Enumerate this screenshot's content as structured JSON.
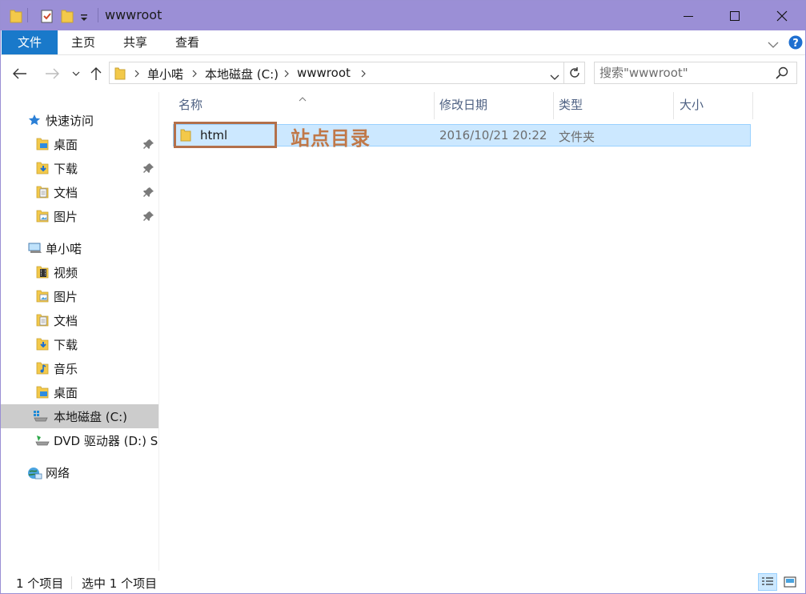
{
  "window": {
    "title": "wwwroot"
  },
  "ribbon": {
    "tabs": [
      {
        "label": "文件"
      },
      {
        "label": "主页"
      },
      {
        "label": "共享"
      },
      {
        "label": "查看"
      }
    ]
  },
  "address": {
    "crumbs": [
      "单小喏",
      "本地磁盘 (C:)",
      "wwwroot"
    ],
    "search_placeholder": "搜索\"wwwroot\""
  },
  "navpane": {
    "quick_access": {
      "label": "快速访问",
      "items": [
        {
          "label": "桌面",
          "icon": "desktop-folder-icon",
          "pinned": true
        },
        {
          "label": "下载",
          "icon": "downloads-folder-icon",
          "pinned": true
        },
        {
          "label": "文档",
          "icon": "documents-folder-icon",
          "pinned": true
        },
        {
          "label": "图片",
          "icon": "pictures-folder-icon",
          "pinned": true
        }
      ]
    },
    "this_pc": {
      "label": "单小喏",
      "items": [
        {
          "label": "视频",
          "icon": "videos-folder-icon"
        },
        {
          "label": "图片",
          "icon": "pictures-folder-icon"
        },
        {
          "label": "文档",
          "icon": "documents-folder-icon"
        },
        {
          "label": "下载",
          "icon": "downloads-folder-icon"
        },
        {
          "label": "音乐",
          "icon": "music-folder-icon"
        },
        {
          "label": "桌面",
          "icon": "desktop-folder-icon"
        },
        {
          "label": "本地磁盘 (C:)",
          "icon": "local-disk-icon",
          "selected": true
        },
        {
          "label": "DVD 驱动器 (D:) SS",
          "icon": "dvd-drive-icon"
        }
      ]
    },
    "network": {
      "label": "网络"
    }
  },
  "columns": {
    "name": "名称",
    "modified": "修改日期",
    "type": "类型",
    "size": "大小"
  },
  "files": [
    {
      "name": "html",
      "modified": "2016/10/21 20:22",
      "type": "文件夹",
      "size": "",
      "selected": true
    }
  ],
  "annotation": {
    "text": "站点目录",
    "color": "#c07848"
  },
  "status": {
    "item_count": "1 个项目",
    "selected_count": "选中 1 个项目"
  },
  "colors": {
    "titlebar": "#9b8fd6",
    "file_tab": "#1979ca",
    "selection": "#cce8ff",
    "folder": "#f3c94a"
  }
}
